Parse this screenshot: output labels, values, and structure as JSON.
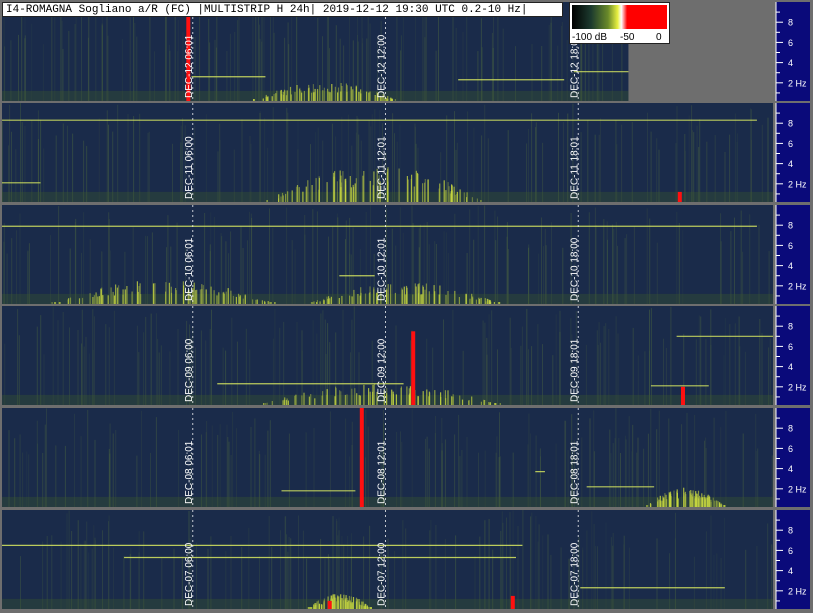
{
  "title": "I4-ROMAGNA Sogliano a/R (FC) |MULTISTRIP H 24h| 2019-12-12 19:30 UTC 0.2-10 Hz|",
  "colorbar": {
    "labels": [
      "-100 dB",
      "-50",
      "0"
    ],
    "colors": [
      "#000000",
      "#1c3a2e",
      "#6a8a2a",
      "#e8f040",
      "#ffffff",
      "#ff0000"
    ]
  },
  "colors": {
    "background": "#6e6e6e",
    "axis_bg": "#0a0a7a",
    "axis_text": "#ffffff",
    "spectro_dark": "#1a2b4a",
    "signal": "#c8d840",
    "hot": "#ff1010",
    "time_grid": "#ffffff"
  },
  "chart_data": {
    "type": "heatmap",
    "y_axis": {
      "ticks": [
        "8",
        "6",
        "4",
        "2 Hz"
      ],
      "values": [
        8,
        6,
        4,
        2
      ],
      "range": [
        0.2,
        10
      ],
      "unit": "Hz"
    },
    "strips": [
      {
        "date": "2019-12-12",
        "time_labels": [
          "DEC-12 06:01",
          "DEC-12 12:00",
          "DEC-12 18:01"
        ],
        "hours": [
          6,
          12,
          18
        ],
        "data_end_hour": 19.5,
        "hot_spots": [
          {
            "hour": 5.8,
            "f_low": 0.2,
            "f_high": 10
          }
        ],
        "tones": [
          {
            "h1": 5.9,
            "h2": 8.2,
            "freq": 2.6
          },
          {
            "h1": 14.2,
            "h2": 17.5,
            "freq": 2.3
          },
          {
            "h1": 17.8,
            "h2": 19.5,
            "freq": 3.1
          }
        ],
        "bursts": [
          {
            "h1": 7.8,
            "h2": 12.3,
            "peak": 1.8
          }
        ]
      },
      {
        "date": "2019-12-11",
        "time_labels": [
          "DEC-11 06:00",
          "DEC-11 12:01",
          "DEC-11 18:01"
        ],
        "hours": [
          6,
          12,
          18
        ],
        "data_end_hour": 24,
        "hot_spots": [
          {
            "hour": 21.1,
            "f_low": 0.2,
            "f_high": 1.2
          }
        ],
        "tones": [
          {
            "h1": 0,
            "h2": 1.2,
            "freq": 2.1
          },
          {
            "h1": 0,
            "h2": 23.5,
            "freq": 8.3
          }
        ],
        "bursts": [
          {
            "h1": 8.2,
            "h2": 15.0,
            "peak": 3.2
          }
        ]
      },
      {
        "date": "2019-12-10",
        "time_labels": [
          "DEC-10 06:01",
          "DEC-10 12:01",
          "DEC-10 18:00"
        ],
        "hours": [
          6,
          12,
          18
        ],
        "data_end_hour": 24,
        "hot_spots": [],
        "tones": [
          {
            "h1": 0,
            "h2": 23.5,
            "freq": 7.9
          },
          {
            "h1": 10.5,
            "h2": 11.6,
            "freq": 3.0
          }
        ],
        "bursts": [
          {
            "h1": 1.5,
            "h2": 8.5,
            "peak": 2.2
          },
          {
            "h1": 9.5,
            "h2": 15.5,
            "peak": 2.0
          }
        ]
      },
      {
        "date": "2019-12-09",
        "time_labels": [
          "DEC-09 06:00",
          "DEC-09 12:00",
          "DEC-09 18:01"
        ],
        "hours": [
          6,
          12,
          18
        ],
        "data_end_hour": 24,
        "hot_spots": [
          {
            "hour": 12.8,
            "f_low": 0.2,
            "f_high": 7.5
          },
          {
            "hour": 21.2,
            "f_low": 0.2,
            "f_high": 2.0
          }
        ],
        "tones": [
          {
            "h1": 6.7,
            "h2": 12.5,
            "freq": 2.3
          },
          {
            "h1": 20.2,
            "h2": 22.0,
            "freq": 2.1
          },
          {
            "h1": 21.0,
            "h2": 24,
            "freq": 7.0
          }
        ],
        "bursts": [
          {
            "h1": 8.0,
            "h2": 15.5,
            "peak": 2.0
          }
        ]
      },
      {
        "date": "2019-12-08",
        "time_labels": [
          "DEC-08 06:01",
          "DEC-08 12:01",
          "DEC-08 18:01"
        ],
        "hours": [
          6,
          12,
          18
        ],
        "data_end_hour": 24,
        "hot_spots": [
          {
            "hour": 11.2,
            "f_low": 0.2,
            "f_high": 10
          }
        ],
        "tones": [
          {
            "h1": 8.7,
            "h2": 11.0,
            "freq": 1.8
          },
          {
            "h1": 18.2,
            "h2": 20.3,
            "freq": 2.2
          },
          {
            "h1": 16.6,
            "h2": 16.9,
            "freq": 3.7
          }
        ],
        "bursts": [
          {
            "h1": 20.0,
            "h2": 22.5,
            "peak": 1.8
          }
        ]
      },
      {
        "date": "2019-12-07",
        "time_labels": [
          "DEC-07 06:00",
          "DEC-07 12:00",
          "DEC-07 18:00"
        ],
        "hours": [
          6,
          12,
          18
        ],
        "data_end_hour": 24,
        "hot_spots": [
          {
            "hour": 10.2,
            "f_low": 0.2,
            "f_high": 1.0
          },
          {
            "hour": 15.9,
            "f_low": 0.2,
            "f_high": 1.5
          }
        ],
        "tones": [
          {
            "h1": 0,
            "h2": 16.2,
            "freq": 6.5
          },
          {
            "h1": 3.8,
            "h2": 16.0,
            "freq": 5.3
          },
          {
            "h1": 18.0,
            "h2": 22.5,
            "freq": 2.3
          }
        ],
        "bursts": [
          {
            "h1": 9.5,
            "h2": 11.5,
            "peak": 1.5
          }
        ]
      }
    ]
  }
}
